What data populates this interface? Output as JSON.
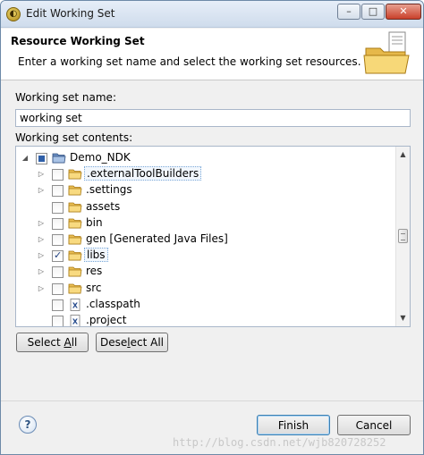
{
  "window": {
    "title": "Edit Working Set",
    "buttons": {
      "minimize": "–",
      "maximize": "□",
      "close": "✕"
    }
  },
  "header": {
    "title": "Resource Working Set",
    "description": "Enter a working set name and select the working set resources."
  },
  "name_field": {
    "label": "Working set name:",
    "value": "working set"
  },
  "contents": {
    "label": "Working set contents:",
    "tree": [
      {
        "label": "Demo_NDK",
        "level": 0,
        "expander": "open",
        "check": "partial",
        "icon": "project-folder-icon"
      },
      {
        "label": ".externalToolBuilders",
        "level": 1,
        "expander": "closed",
        "check": "unchecked",
        "icon": "folder-icon",
        "focused": true
      },
      {
        "label": ".settings",
        "level": 1,
        "expander": "closed",
        "check": "unchecked",
        "icon": "folder-icon"
      },
      {
        "label": "assets",
        "level": 1,
        "expander": "none",
        "check": "unchecked",
        "icon": "folder-icon"
      },
      {
        "label": "bin",
        "level": 1,
        "expander": "closed",
        "check": "unchecked",
        "icon": "folder-icon"
      },
      {
        "label": "gen [Generated Java Files]",
        "level": 1,
        "expander": "closed",
        "check": "unchecked",
        "icon": "folder-icon"
      },
      {
        "label": "libs",
        "level": 1,
        "expander": "closed",
        "check": "checked",
        "icon": "folder-icon",
        "focused": true
      },
      {
        "label": "res",
        "level": 1,
        "expander": "closed",
        "check": "unchecked",
        "icon": "folder-icon"
      },
      {
        "label": "src",
        "level": 1,
        "expander": "closed",
        "check": "unchecked",
        "icon": "folder-icon"
      },
      {
        "label": ".classpath",
        "level": 1,
        "expander": "none",
        "check": "unchecked",
        "icon": "xml-file-icon"
      },
      {
        "label": ".project",
        "level": 1,
        "expander": "none",
        "check": "unchecked",
        "icon": "xml-file-icon"
      }
    ]
  },
  "buttons": {
    "select_all": "Select All",
    "deselect_all": "Deselect All",
    "finish": "Finish",
    "cancel": "Cancel",
    "help": "?"
  },
  "watermark": "http://blog.csdn.net/wjb820728252"
}
